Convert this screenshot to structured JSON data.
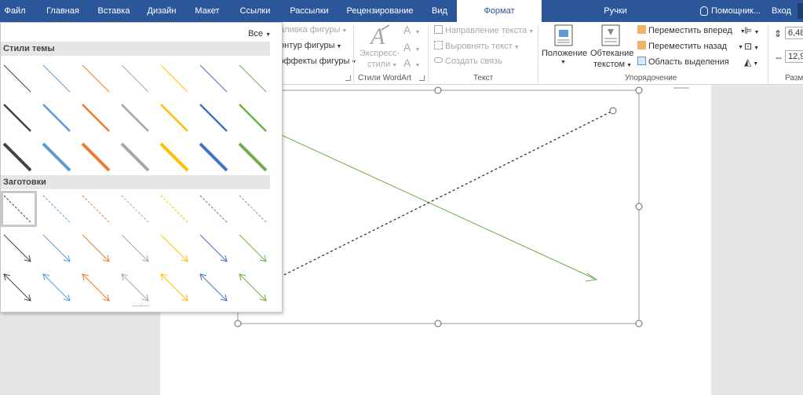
{
  "tabs": [
    {
      "label": "Файл",
      "active": false
    },
    {
      "label": "Главная",
      "active": false
    },
    {
      "label": "Вставка",
      "active": false
    },
    {
      "label": "Дизайн",
      "active": false
    },
    {
      "label": "Макет",
      "active": false
    },
    {
      "label": "Ссылки",
      "active": false
    },
    {
      "label": "Рассылки",
      "active": false
    },
    {
      "label": "Рецензирование",
      "active": false
    },
    {
      "label": "Вид",
      "active": false
    },
    {
      "label": "Формат",
      "active": true
    },
    {
      "label": "Ручки",
      "active": false
    }
  ],
  "header_right": {
    "assistant": "Помощник...",
    "login": "Вход"
  },
  "ribbon": {
    "shape_styles": {
      "fill": "аливка фигуры",
      "outline": "онтур фигуры",
      "effects": "эффекты фигуры"
    },
    "wordart": {
      "express_styles_line1": "Экспресс-",
      "express_styles_line2": "стили",
      "group_label": "Стили WordArt"
    },
    "text": {
      "direction": "Направление текста",
      "align": "Выровнять текст",
      "link": "Создать связь",
      "group_label": "Текст"
    },
    "arrange": {
      "position": "Положение",
      "wrap_line1": "Обтекание",
      "wrap_line2": "текстом",
      "bring_forward": "Переместить вперед",
      "send_backward": "Переместить назад",
      "selection_pane": "Область выделения",
      "group_label": "Упорядочение"
    },
    "size": {
      "height": "6,48",
      "width": "12,9",
      "group_label": "Разм"
    }
  },
  "gallery": {
    "all_label": "Все",
    "theme_styles_header": "Стили темы",
    "presets_header": "Заготовки",
    "colors": [
      "#444444",
      "#5b9bd5",
      "#ed7d31",
      "#a5a5a5",
      "#ffc000",
      "#4472c4",
      "#70ad47"
    ]
  },
  "canvas": {
    "green_arrow_color": "#70ad47",
    "dashed_line_color": "#222222"
  }
}
